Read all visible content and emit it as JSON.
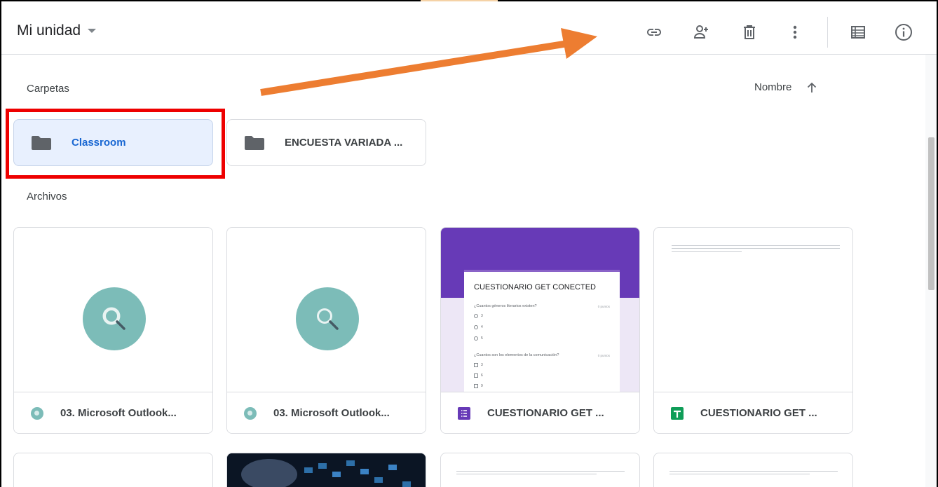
{
  "header": {
    "title": "Mi unidad",
    "toolbar": [
      "link-icon",
      "share-person-icon",
      "trash-icon",
      "more-vert-icon",
      "list-view-icon",
      "info-icon"
    ]
  },
  "folders_section": {
    "label": "Carpetas",
    "sort_label": "Nombre",
    "folders": [
      {
        "name": "Classroom",
        "selected": true
      },
      {
        "name": "ENCUESTA VARIADA ...",
        "selected": false
      }
    ]
  },
  "files_section": {
    "label": "Archivos",
    "files": [
      {
        "name": "03. Microsoft Outlook...",
        "type": "search-icon"
      },
      {
        "name": "03. Microsoft Outlook...",
        "type": "search-icon"
      },
      {
        "name": "CUESTIONARIO GET ...",
        "type": "forms-icon"
      },
      {
        "name": "CUESTIONARIO GET ...",
        "type": "sheets-icon"
      }
    ]
  },
  "form_preview": {
    "title": "CUESTIONARIO GET CONECTED",
    "q1": "¿Cuantos géneros literarios existen?",
    "q1_points": "0 puntos",
    "q1_options": [
      "3",
      "4",
      "5"
    ],
    "q2": "¿Cuantos son los elementos de la comunicación?",
    "q2_points": "0 puntos",
    "q2_options": [
      "3",
      "6",
      "9"
    ]
  },
  "colors": {
    "selected_bg": "#e8f0fe",
    "selected_text": "#1967d2",
    "forms_purple": "#673ab7",
    "sheets_green": "#0f9d58",
    "annotation_red": "#ee0000",
    "annotation_orange": "#ed7d31"
  }
}
